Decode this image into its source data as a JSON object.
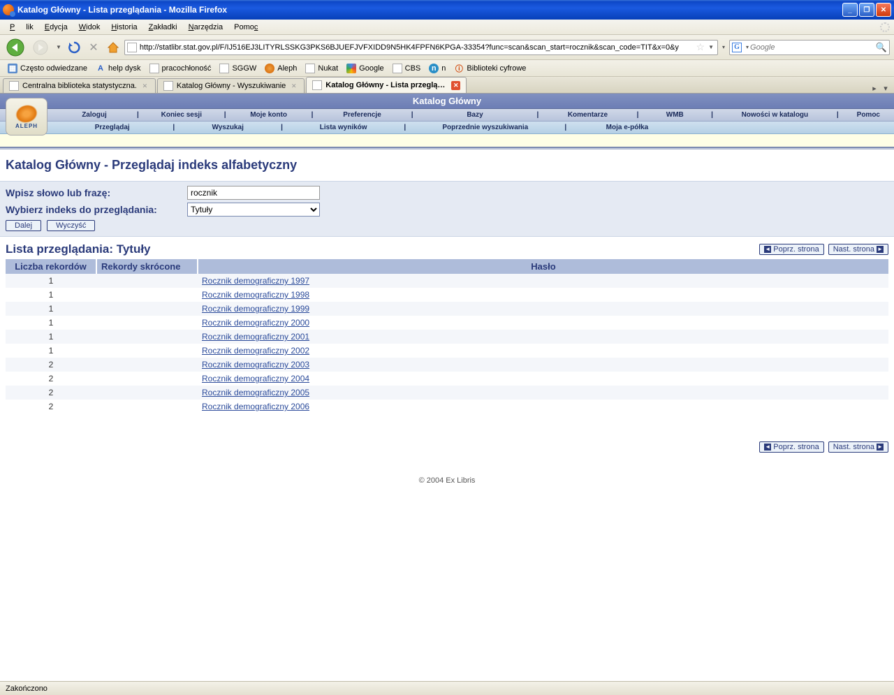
{
  "window": {
    "title": "Katalog Główny - Lista przeglądania - Mozilla Firefox"
  },
  "menubar": {
    "file": "Plik",
    "edit": "Edycja",
    "view": "Widok",
    "history": "Historia",
    "bookmarks": "Zakładki",
    "tools": "Narzędzia",
    "help": "Pomoc"
  },
  "toolbar": {
    "url": "http://statlibr.stat.gov.pl/F/IJ516EJ3LITYRLSSKG3PKS6BJUEFJVFXIDD9N5HK4FPFN6KPGA-33354?func=scan&scan_start=rocznik&scan_code=TIT&x=0&y",
    "search_placeholder": "Google",
    "search_engine_letter": "G"
  },
  "bookmarks": {
    "items": [
      {
        "label": "Często odwiedzane",
        "icon": "blue"
      },
      {
        "label": "help dysk",
        "icon": "A"
      },
      {
        "label": "pracochłoność",
        "icon": "page"
      },
      {
        "label": "SGGW",
        "icon": "page"
      },
      {
        "label": "Aleph",
        "icon": "aleph"
      },
      {
        "label": "Nukat",
        "icon": "page"
      },
      {
        "label": "Google",
        "icon": "google"
      },
      {
        "label": "CBS",
        "icon": "page"
      },
      {
        "label": "n",
        "icon": "n"
      },
      {
        "label": "Biblioteki cyfrowe",
        "icon": "bc"
      }
    ]
  },
  "tabs": {
    "items": [
      {
        "label": "Centralna biblioteka statystyczna.",
        "active": false
      },
      {
        "label": "Katalog Główny - Wyszukiwanie",
        "active": false
      },
      {
        "label": "Katalog Główny - Lista przegląda...",
        "active": true
      }
    ]
  },
  "aleph": {
    "logo_text": "ALEPH",
    "banner": "Katalog Główny",
    "nav1": [
      "Zaloguj",
      "Koniec sesji",
      "Moje konto",
      "Preferencje",
      "Bazy",
      "Komentarze",
      "WMB",
      "Nowości w katalogu",
      "Pomoc"
    ],
    "nav2": [
      "Przeglądaj",
      "Wyszukaj",
      "Lista wyników",
      "Poprzednie wyszukiwania",
      "Moja e-półka"
    ]
  },
  "page": {
    "title": "Katalog Główny - Przeglądaj indeks alfabetyczny",
    "label_phrase": "Wpisz słowo lub frazę:",
    "input_value": "rocznik",
    "label_index": "Wybierz indeks do przeglądania:",
    "select_value": "Tytuły",
    "btn_go": "Dalej",
    "btn_clear": "Wyczyść",
    "list_title": "Lista przeglądania: Tytuły",
    "prev": "Poprz. strona",
    "next": "Nast. strona",
    "th_count": "Liczba rekordów",
    "th_short": "Rekordy skrócone",
    "th_entry": "Hasło",
    "rows": [
      {
        "count": "1",
        "entry": "Rocznik demograficzny 1997"
      },
      {
        "count": "1",
        "entry": "Rocznik demograficzny 1998"
      },
      {
        "count": "1",
        "entry": "Rocznik demograficzny 1999"
      },
      {
        "count": "1",
        "entry": "Rocznik demograficzny 2000"
      },
      {
        "count": "1",
        "entry": "Rocznik demograficzny 2001"
      },
      {
        "count": "1",
        "entry": "Rocznik demograficzny 2002"
      },
      {
        "count": "2",
        "entry": "Rocznik demograficzny 2003"
      },
      {
        "count": "2",
        "entry": "Rocznik demograficzny 2004"
      },
      {
        "count": "2",
        "entry": "Rocznik demograficzny 2005"
      },
      {
        "count": "2",
        "entry": "Rocznik demograficzny 2006"
      }
    ],
    "footer": "© 2004 Ex Libris"
  },
  "statusbar": {
    "text": "Zakończono"
  }
}
